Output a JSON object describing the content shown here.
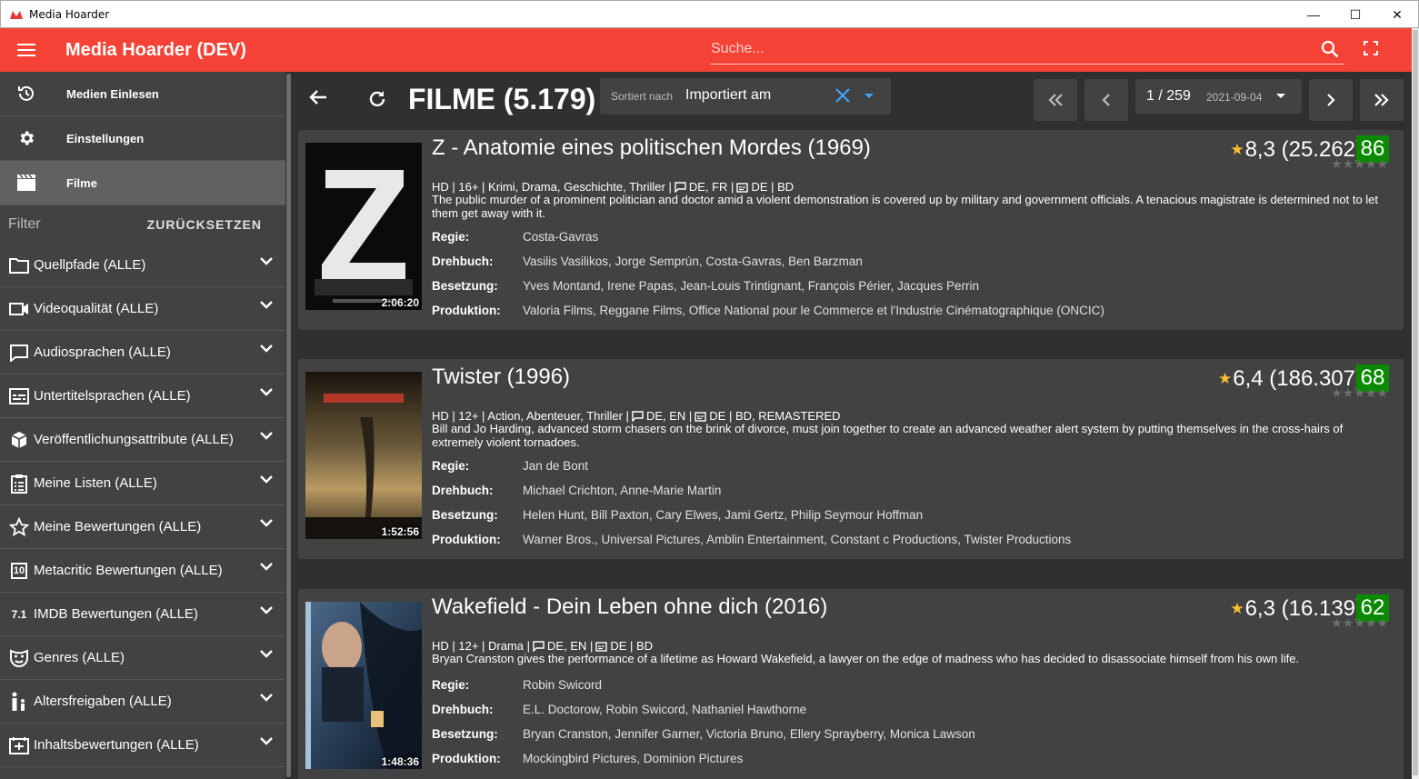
{
  "window": {
    "title": "Media Hoarder"
  },
  "appbar": {
    "title": "Media Hoarder (DEV)",
    "search_placeholder": "Suche..."
  },
  "sidebar": {
    "nav": [
      {
        "label": "Medien Einlesen",
        "icon": "import-clock-icon"
      },
      {
        "label": "Einstellungen",
        "icon": "gear-icon"
      },
      {
        "label": "Filme",
        "icon": "clapperboard-icon",
        "active": true
      }
    ],
    "filter_label": "Filter",
    "reset_label": "ZURÜCKSETZEN",
    "filters": [
      {
        "label": "Quellpfade (ALLE)",
        "icon": "folder-icon"
      },
      {
        "label": "Videoqualität (ALLE)",
        "icon": "video-camera-icon"
      },
      {
        "label": "Audiosprachen (ALLE)",
        "icon": "speech-bubble-icon"
      },
      {
        "label": "Untertitelsprachen (ALLE)",
        "icon": "subtitles-icon"
      },
      {
        "label": "Veröffentlichungsattribute (ALLE)",
        "icon": "cube-icon"
      },
      {
        "label": "Meine Listen (ALLE)",
        "icon": "clipboard-list-icon"
      },
      {
        "label": "Meine Bewertungen (ALLE)",
        "icon": "star-outline-icon"
      },
      {
        "label": "Metacritic Bewertungen (ALLE)",
        "icon": "metacritic-10-icon",
        "icon_text": "10"
      },
      {
        "label": "IMDB Bewertungen (ALLE)",
        "icon": "imdb-rating-icon",
        "icon_text": "7.1"
      },
      {
        "label": "Genres (ALLE)",
        "icon": "theater-mask-icon"
      },
      {
        "label": "Altersfreigaben (ALLE)",
        "icon": "family-icon"
      },
      {
        "label": "Inhaltsbewertungen (ALLE)",
        "icon": "content-rating-icon"
      }
    ]
  },
  "toolbar": {
    "heading": "FILME (5.179)",
    "sort_label": "Sortiert nach",
    "sort_value": "Importiert am",
    "page": "1 / 259",
    "page_date": "2021-09-04"
  },
  "field_labels": {
    "director": "Regie:",
    "writer": "Drehbuch:",
    "cast": "Besetzung:",
    "production": "Produktion:"
  },
  "movies": [
    {
      "title": "Z - Anatomie eines politischen Mordes (1969)",
      "runtime": "2:06:20",
      "rating": "8,3 (25.262)",
      "metacritic": "86",
      "my_stars": 0,
      "info_prefix": "HD | 16+ | Krimi, Drama, Geschichte, Thriller |",
      "audio": "DE, FR |",
      "subs": "DE | BD",
      "description": "The public murder of a prominent politician and doctor amid a violent demonstration is covered up by military and government officials. A tenacious magistrate is determined not to let them get away with it.",
      "director": "Costa-Gavras",
      "writer": "Vasilis Vasilikos, Jorge Semprún, Costa-Gavras, Ben Barzman",
      "cast": "Yves Montand, Irene Papas, Jean-Louis Trintignant, François Périer, Jacques Perrin",
      "production": "Valoria Films, Reggane Films, Office National pour le Commerce et l'Industrie Cinématographique (ONCIC)"
    },
    {
      "title": "Twister (1996)",
      "runtime": "1:52:56",
      "rating": "6,4 (186.307)",
      "metacritic": "68",
      "my_stars": 0,
      "info_prefix": "HD | 12+ | Action, Abenteuer, Thriller |",
      "audio": "DE, EN |",
      "subs": "DE | BD, REMASTERED",
      "description": "Bill and Jo Harding, advanced storm chasers on the brink of divorce, must join together to create an advanced weather alert system by putting themselves in the cross-hairs of extremely violent tornadoes.",
      "director": "Jan de Bont",
      "writer": "Michael Crichton, Anne-Marie Martin",
      "cast": "Helen Hunt, Bill Paxton, Cary Elwes, Jami Gertz, Philip Seymour Hoffman",
      "production": "Warner Bros., Universal Pictures, Amblin Entertainment, Constant c Productions, Twister Productions"
    },
    {
      "title": "Wakefield - Dein Leben ohne dich (2016)",
      "runtime": "1:48:36",
      "rating": "6,3 (16.139)",
      "metacritic": "62",
      "my_stars": 0,
      "info_prefix": "HD | 12+ | Drama |",
      "audio": "DE, EN |",
      "subs": "DE | BD",
      "description": "Bryan Cranston gives the performance of a lifetime as Howard Wakefield, a lawyer on the edge of madness who has decided to disassociate himself from his own life.",
      "director": "Robin Swicord",
      "writer": "E.L. Doctorow, Robin Swicord, Nathaniel Hawthorne",
      "cast": "Bryan Cranston, Jennifer Garner, Victoria Bruno, Ellery Sprayberry, Monica Lawson",
      "production": "Mockingbird Pictures, Dominion Pictures"
    }
  ]
}
